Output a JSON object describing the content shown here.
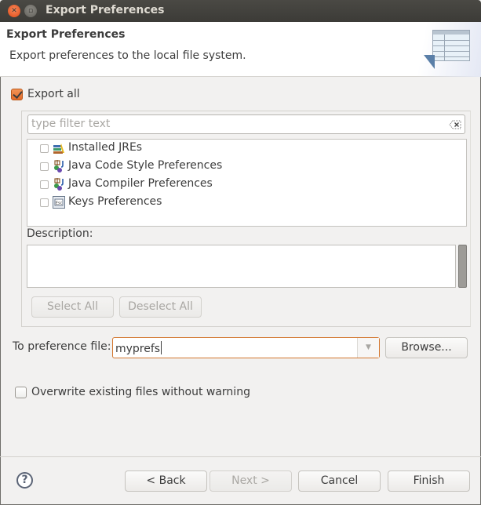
{
  "window": {
    "title": "Export Preferences"
  },
  "header": {
    "title": "Export Preferences",
    "description": "Export preferences to the local file system.",
    "graphic": "table-export-icon"
  },
  "export_all": {
    "label": "Export all",
    "checked": true
  },
  "filter": {
    "placeholder": "type filter text",
    "value": "",
    "clear_icon": "clear-text-icon"
  },
  "tree": {
    "items": [
      {
        "label": "Installed JREs",
        "icon": "jre-icon",
        "checked": false
      },
      {
        "label": "Java Code Style Preferences",
        "icon": "java-preferences-icon",
        "checked": false
      },
      {
        "label": "Java Compiler Preferences",
        "icon": "java-preferences-icon",
        "checked": false
      },
      {
        "label": "Keys Preferences",
        "icon": "keys-icon",
        "checked": false
      }
    ]
  },
  "description": {
    "label": "Description:",
    "value": ""
  },
  "selection_buttons": {
    "select_all": "Select All",
    "deselect_all": "Deselect All"
  },
  "destination": {
    "label": "To preference file:",
    "value": "myprefs",
    "browse_label": "Browse..."
  },
  "overwrite": {
    "label": "Overwrite existing files without warning",
    "checked": false
  },
  "footer": {
    "help": "?",
    "back": "< Back",
    "next": "Next >",
    "cancel": "Cancel",
    "finish": "Finish"
  }
}
